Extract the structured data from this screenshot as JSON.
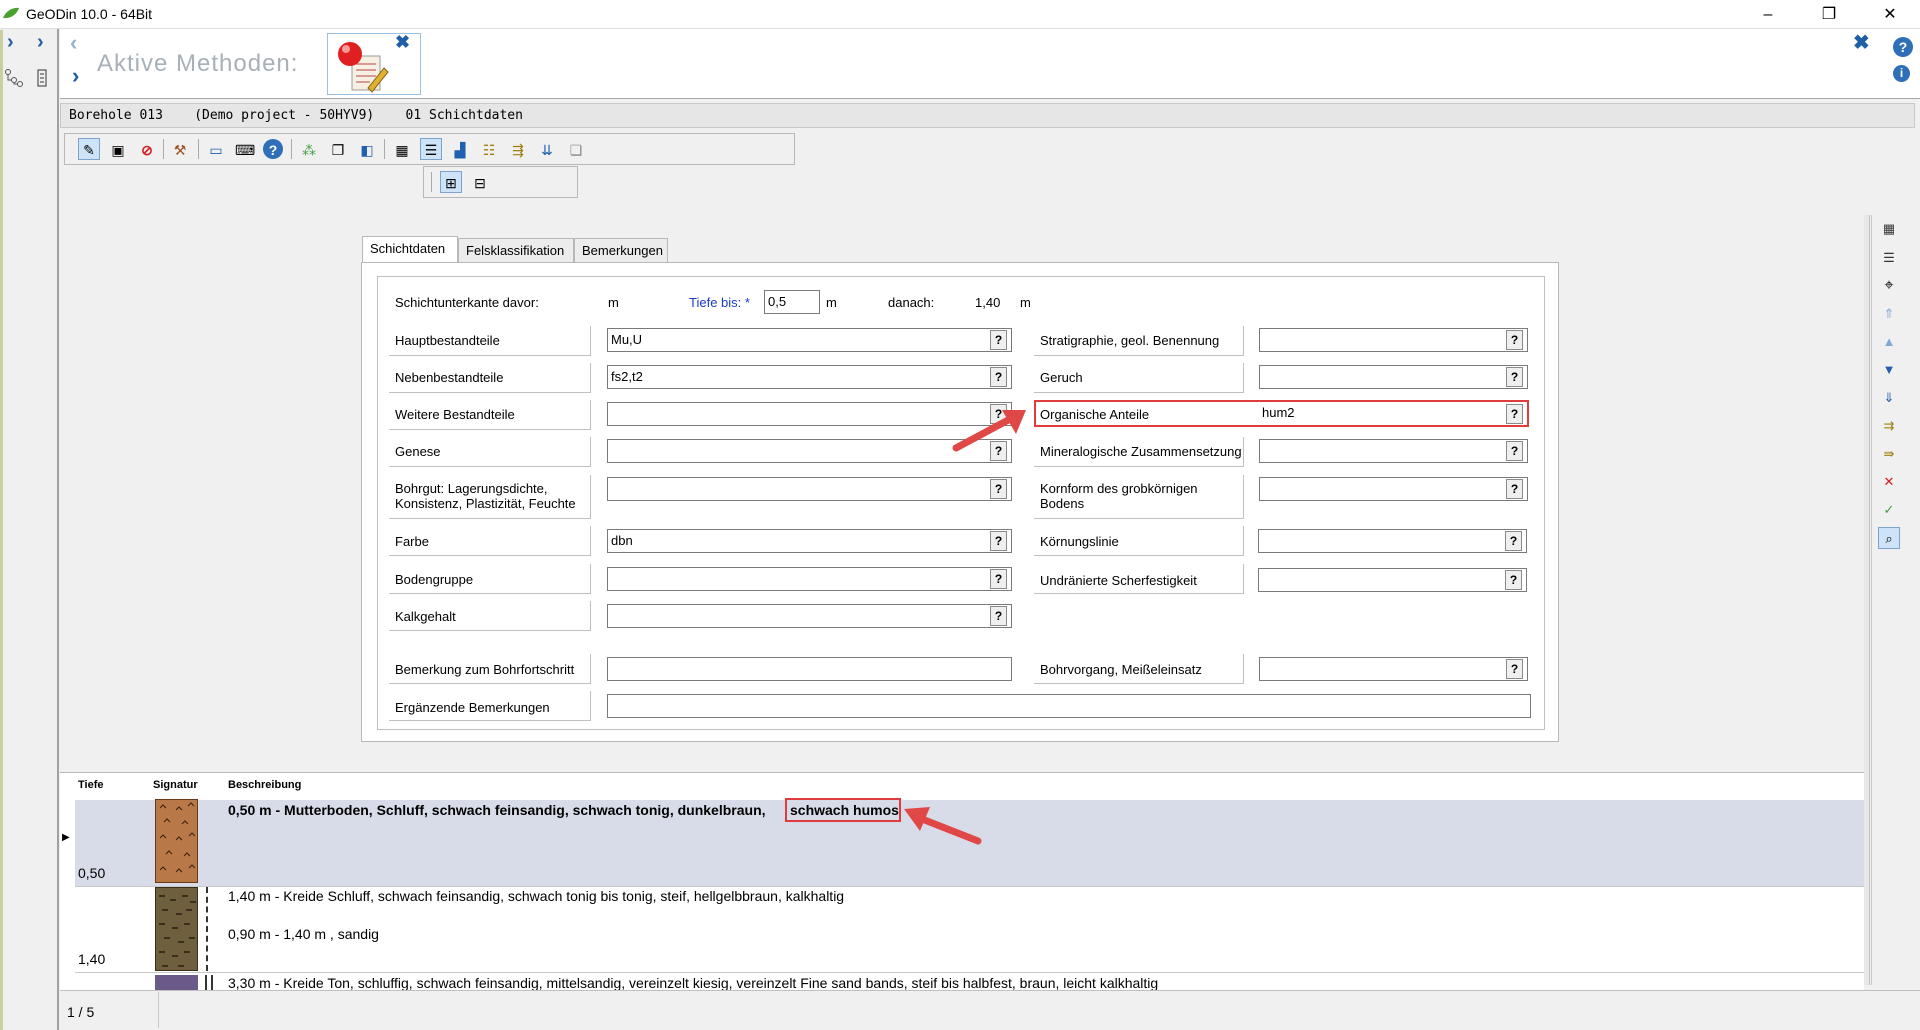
{
  "window": {
    "title": "GeODin 10.0  - 64Bit",
    "minimize": "–",
    "restore": "❐",
    "close": "✕"
  },
  "methods": {
    "title": "Aktive Methoden:",
    "close_glyph": "✖",
    "help_glyph": "?",
    "info_glyph": "i"
  },
  "breadcrumb": "Borehole 013    (Demo project - 50HYV9)    01 Schichtdaten",
  "tabs": [
    "Schichtdaten",
    "Felsklassifikation",
    "Bemerkungen"
  ],
  "form": {
    "depth_row": {
      "before_label": "Schichtunterkante davor:",
      "before_unit": "m",
      "until_label": "Tiefe bis: *",
      "until_value": "0,5",
      "until_unit": "m",
      "after_label": "danach:",
      "after_value": "1,40",
      "after_unit": "m"
    },
    "left_fields": [
      {
        "label": "Hauptbestandteile",
        "value": "Mu,U"
      },
      {
        "label": "Nebenbestandteile",
        "value": "fs2,t2"
      },
      {
        "label": "Weitere Bestandteile",
        "value": ""
      },
      {
        "label": "Genese",
        "value": ""
      },
      {
        "label": "Bohrgut: Lagerungsdichte, Konsistenz, Plastizität, Feuchte",
        "value": ""
      },
      {
        "label": "Farbe",
        "value": "dbn"
      },
      {
        "label": "Bodengruppe",
        "value": ""
      },
      {
        "label": "Kalkgehalt",
        "value": ""
      }
    ],
    "right_fields": [
      {
        "label": "Stratigraphie, geol. Benennung",
        "value": ""
      },
      {
        "label": "Geruch",
        "value": ""
      },
      {
        "label": "Organische Anteile",
        "value": "hum2"
      },
      {
        "label": "Mineralogische Zusammensetzung",
        "value": ""
      },
      {
        "label": "Kornform des grobkörnigen Bodens",
        "value": ""
      },
      {
        "label": "Körnungslinie",
        "value": ""
      },
      {
        "label": "Undränierte Scherfestigkeit",
        "value": ""
      }
    ],
    "bottom_fields": {
      "bohrfortschritt_label": "Bemerkung zum Bohrfortschritt",
      "bohrfortschritt_value": "",
      "bohrvorgang_label": "Bohrvorgang, Meißeleinsatz",
      "bohrvorgang_value": "",
      "ergaenzend_label": "Ergänzende Bemerkungen",
      "ergaenzend_value": ""
    },
    "help_glyph": "?"
  },
  "description_table": {
    "headers": [
      "Tiefe",
      "Signatur",
      "Beschreibung"
    ],
    "rows": [
      {
        "depth": "0,50",
        "text_main": "0,50 m - Mutterboden, Schluff, schwach feinsandig, schwach tonig, dunkelbraun,",
        "text_highlight": "schwach humos",
        "selected": true,
        "color": "#b87848"
      },
      {
        "depth": "1,40",
        "text_main": "1,40 m - Kreide Schluff, schwach feinsandig, schwach tonig bis tonig, steif, hellgelbbraun, kalkhaltig",
        "text_sub": "0,90 m - 1,40 m , sandig",
        "selected": false,
        "color": "#6e5f3e"
      },
      {
        "depth": "",
        "text_main": "3,30 m - Kreide Ton, schluffig, schwach feinsandig, mittelsandig, vereinzelt kiesig, vereinzelt Fine sand bands, steif bis halbfest, braun, leicht kalkhaltig",
        "selected": false,
        "color": "#6a5a8a"
      }
    ]
  },
  "status": {
    "record": "1 / 5"
  },
  "colors": {
    "accent": "#1f5fa8",
    "highlight": "#e03c3c",
    "selected_row": "#d8dce8"
  }
}
